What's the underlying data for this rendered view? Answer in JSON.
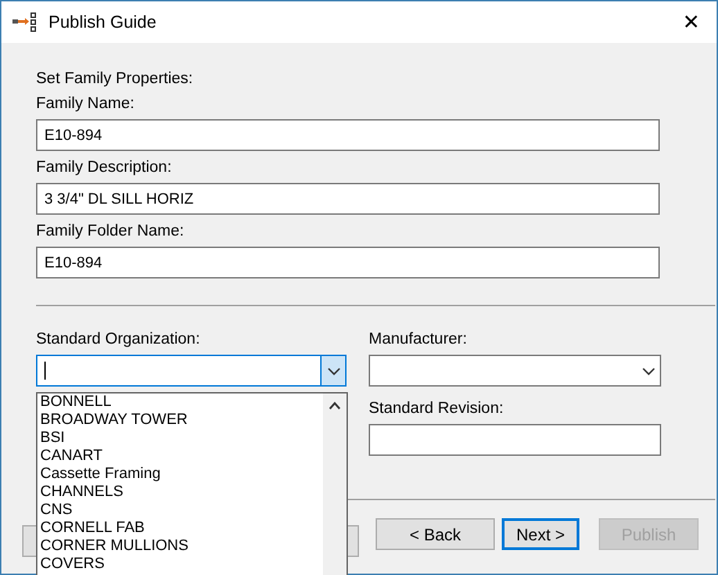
{
  "window": {
    "title": "Publish Guide",
    "close": "✕"
  },
  "heading": "Set Family Properties:",
  "fields": [
    {
      "label": "Family Name:",
      "value": "E10-894"
    },
    {
      "label": "Family Description:",
      "value": "3 3/4\" DL SILL HORIZ"
    },
    {
      "label": "Family Folder Name:",
      "value": "E10-894"
    }
  ],
  "standard_organization": {
    "label": "Standard Organization:",
    "expanded": true,
    "options": [
      "BONNELL",
      "BROADWAY TOWER",
      "BSI",
      "CANART",
      "Cassette Framing",
      "CHANNELS",
      "CNS",
      "CORNELL FAB",
      "CORNER MULLIONS",
      "COVERS"
    ]
  },
  "manufacturer": {
    "label": "Manufacturer:",
    "expanded": false
  },
  "standard_revision": {
    "label": "Standard Revision:"
  },
  "buttons": [
    {
      "label": "< Back",
      "disabled": false,
      "default": false
    },
    {
      "label": "Next >",
      "disabled": false,
      "default": true
    },
    {
      "label": "Publish",
      "disabled": true,
      "default": false
    }
  ]
}
